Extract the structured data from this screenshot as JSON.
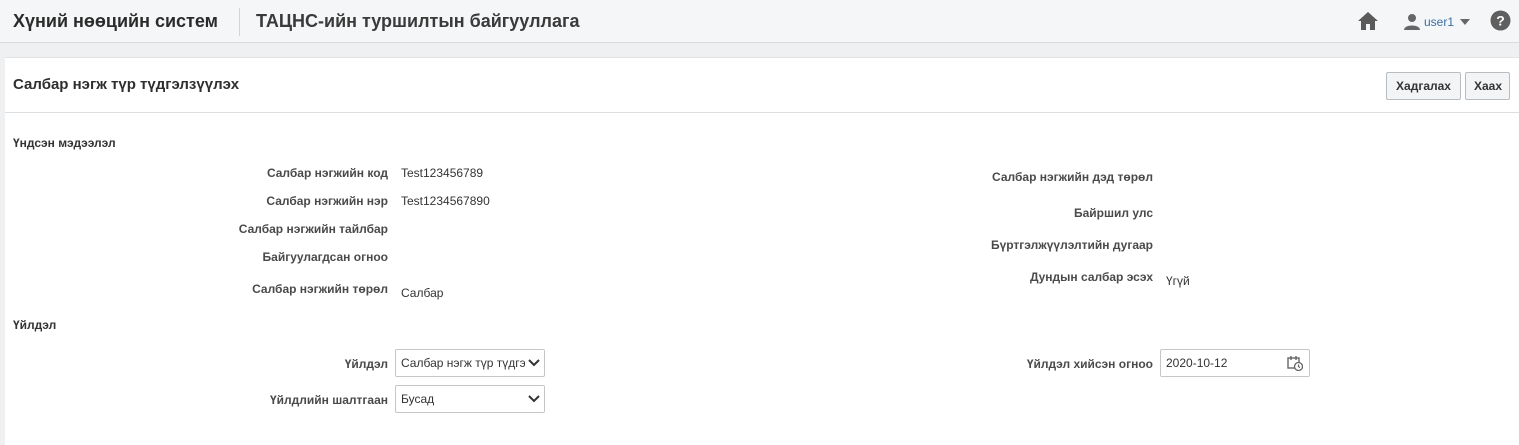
{
  "header": {
    "app_title": "Хүний нөөцийн систем",
    "org_title": "ТАЦНС-ийн туршилтын байгууллага",
    "user_name": "user1",
    "icons": [
      "home-icon",
      "user-icon",
      "caret-down-icon",
      "help-icon"
    ]
  },
  "page": {
    "title": "Салбар нэгж түр түдгэлзүүлэх",
    "save_label": "Хадгалах",
    "close_label": "Хаах"
  },
  "basic_info": {
    "section_title": "Үндсэн мэдээлэл",
    "left_fields": [
      {
        "label": "Салбар нэгжийн код",
        "value": "Test123456789"
      },
      {
        "label": "Салбар нэгжийн нэр",
        "value": "Test1234567890"
      },
      {
        "label": "Салбар нэгжийн тайлбар",
        "value": ""
      },
      {
        "label": "Байгуулагдсан огноо",
        "value": ""
      },
      {
        "label": "Салбар нэгжийн төрөл",
        "value": "Салбар"
      }
    ],
    "right_fields": [
      {
        "label": "Салбар нэгжийн дэд төрөл",
        "value": ""
      },
      {
        "label": "Байршил улс",
        "value": ""
      },
      {
        "label": "Бүртгэлжүүлэлтийн дугаар",
        "value": ""
      },
      {
        "label": "Дундын салбар эсэх",
        "value": "Үгүй"
      }
    ]
  },
  "action": {
    "section_title": "Үйлдэл",
    "action_label": "Үйлдэл",
    "action_value": "Салбар нэгж түр түдгэлзүүлэх",
    "reason_label": "Үйлдлийн шалтгаан",
    "reason_value": "Бусад",
    "date_label": "Үйлдэл хийсэн огноо",
    "date_value": "2020-10-12"
  },
  "colors": {
    "accent_link": "#3b6ea5",
    "panel_bg": "#ffffff",
    "page_bg": "#eef0f2"
  }
}
